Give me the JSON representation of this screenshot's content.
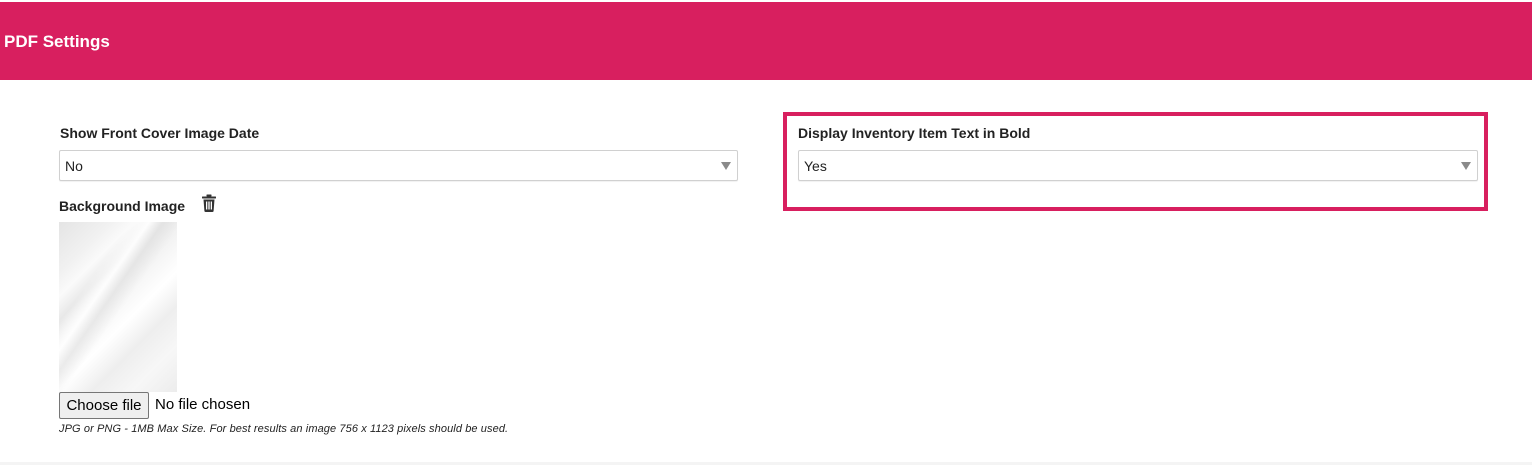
{
  "header": {
    "title": "PDF Settings",
    "color": "#d81f5f"
  },
  "front_cover_date": {
    "label": "Show Front Cover Image Date",
    "value": "No"
  },
  "inventory_bold": {
    "label": "Display Inventory Item Text in Bold",
    "value": "Yes",
    "highlight_color": "#d81f5f"
  },
  "background_image": {
    "label": "Background Image",
    "delete_icon": "trash-icon",
    "choose_file_label": "Choose file",
    "file_status": "No file chosen",
    "hint": "JPG or PNG - 1MB Max Size. For best results an image 756 x 1123 pixels should be used."
  }
}
